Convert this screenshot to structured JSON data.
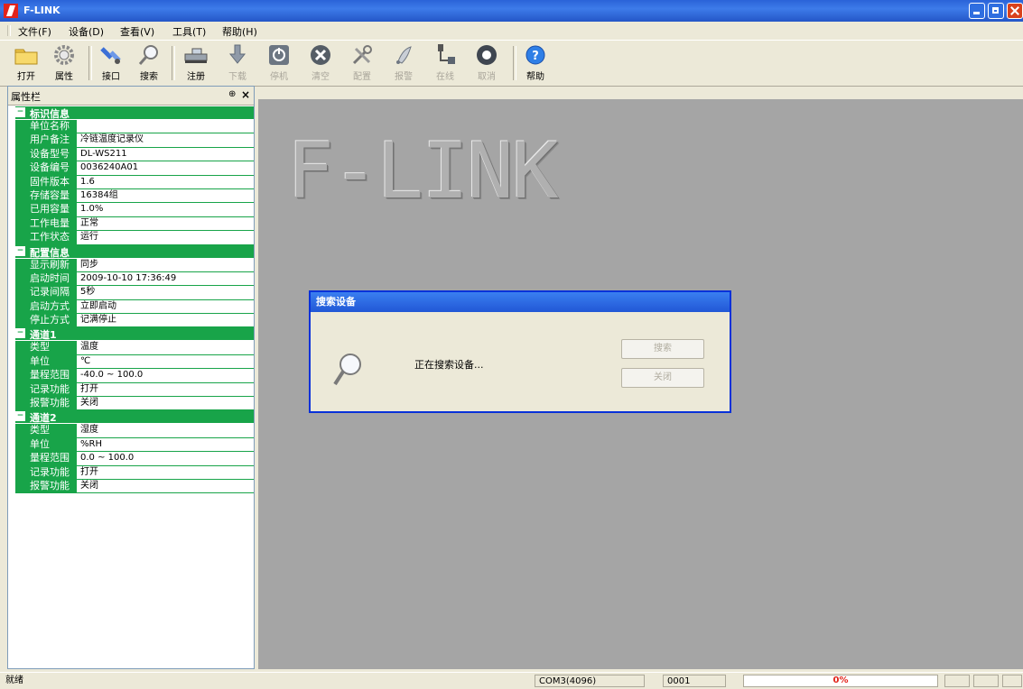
{
  "window": {
    "title": "F-LINK"
  },
  "menu": [
    "文件(F)",
    "设备(D)",
    "查看(V)",
    "工具(T)",
    "帮助(H)"
  ],
  "toolbar": {
    "open": "打开",
    "props": "属性",
    "interface": "接口",
    "search": "搜索",
    "register": "注册",
    "download": "下载",
    "stop": "停机",
    "clear": "清空",
    "config": "配置",
    "alarm": "报警",
    "online": "在线",
    "cancel": "取消",
    "help": "帮助"
  },
  "panel": {
    "title": "属性栏",
    "pin": "⊕",
    "close": "×",
    "sections": [
      {
        "title": "标识信息",
        "rows": [
          {
            "k": "单位名称",
            "v": ""
          },
          {
            "k": "用户备注",
            "v": "冷链温度记录仪"
          },
          {
            "k": "设备型号",
            "v": "DL-WS211"
          },
          {
            "k": "设备编号",
            "v": "0036240A01"
          },
          {
            "k": "固件版本",
            "v": "1.6"
          },
          {
            "k": "存储容量",
            "v": "16384组"
          },
          {
            "k": "已用容量",
            "v": "1.0%"
          },
          {
            "k": "工作电量",
            "v": "正常"
          },
          {
            "k": "工作状态",
            "v": "运行"
          }
        ]
      },
      {
        "title": "配置信息",
        "rows": [
          {
            "k": "显示刷新",
            "v": "同步"
          },
          {
            "k": "启动时间",
            "v": "2009-10-10 17:36:49"
          },
          {
            "k": "记录间隔",
            "v": "5秒"
          },
          {
            "k": "启动方式",
            "v": "立即启动"
          },
          {
            "k": "停止方式",
            "v": "记满停止"
          }
        ]
      },
      {
        "title": "通道1",
        "rows": [
          {
            "k": "类型",
            "v": "温度"
          },
          {
            "k": "单位",
            "v": "℃"
          },
          {
            "k": "量程范围",
            "v": "-40.0 ~ 100.0"
          },
          {
            "k": "记录功能",
            "v": "打开"
          },
          {
            "k": "报警功能",
            "v": "关闭"
          }
        ]
      },
      {
        "title": "通道2",
        "rows": [
          {
            "k": "类型",
            "v": "湿度"
          },
          {
            "k": "单位",
            "v": "%RH"
          },
          {
            "k": "量程范围",
            "v": "0.0 ~ 100.0"
          },
          {
            "k": "记录功能",
            "v": "打开"
          },
          {
            "k": "报警功能",
            "v": "关闭"
          }
        ]
      }
    ]
  },
  "logo": "F-LINK",
  "dialog": {
    "title": "搜索设备",
    "message": "正在搜索设备...",
    "search_btn": "搜索",
    "close_btn": "关闭"
  },
  "status": {
    "left": "就绪",
    "cell1": "COM3(4096)",
    "cell2": "0001",
    "progress_text": "0%",
    "progress_fraction": 0
  },
  "colors": {
    "accent": "#18a449",
    "title_blue": "#2456c7",
    "workspace": "#a5a5a5"
  }
}
